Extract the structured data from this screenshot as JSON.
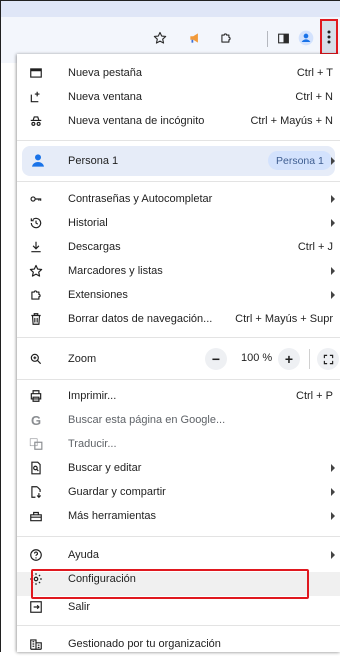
{
  "toolbar": {
    "icons": [
      "star-icon",
      "extension-megaphone-icon",
      "extensions-puzzle-icon",
      "side-panel-icon",
      "profile-icon",
      "more-menu-icon"
    ]
  },
  "menu": {
    "new_tab": {
      "label": "Nueva pestaña",
      "shortcut": "Ctrl + T"
    },
    "new_window": {
      "label": "Nueva ventana",
      "shortcut": "Ctrl + N"
    },
    "incognito": {
      "label": "Nueva ventana de incógnito",
      "shortcut": "Ctrl + Mayús + N"
    },
    "profile": {
      "label": "Persona 1",
      "badge": "Persona 1"
    },
    "passwords": {
      "label": "Contraseñas y Autocompletar"
    },
    "history": {
      "label": "Historial"
    },
    "downloads": {
      "label": "Descargas",
      "shortcut": "Ctrl + J"
    },
    "bookmarks": {
      "label": "Marcadores y listas"
    },
    "extensions": {
      "label": "Extensiones"
    },
    "clear_data": {
      "label": "Borrar datos de navegación...",
      "shortcut": "Ctrl + Mayús + Supr"
    },
    "zoom": {
      "label": "Zoom",
      "minus": "−",
      "value": "100 %",
      "plus": "+"
    },
    "print": {
      "label": "Imprimir...",
      "shortcut": "Ctrl + P"
    },
    "google_search": {
      "label": "Buscar esta página en Google..."
    },
    "translate": {
      "label": "Traducir..."
    },
    "find_edit": {
      "label": "Buscar y editar"
    },
    "save_share": {
      "label": "Guardar y compartir"
    },
    "more_tools": {
      "label": "Más herramientas"
    },
    "help": {
      "label": "Ayuda"
    },
    "settings": {
      "label": "Configuración"
    },
    "exit": {
      "label": "Salir"
    },
    "managed": {
      "label": "Gestionado por tu organización"
    }
  },
  "colors": {
    "highlight": "#e0181f",
    "profile_bg": "#e6ecf8",
    "pill_bg": "#d3e2fd",
    "avatar": "#1a73e8"
  }
}
